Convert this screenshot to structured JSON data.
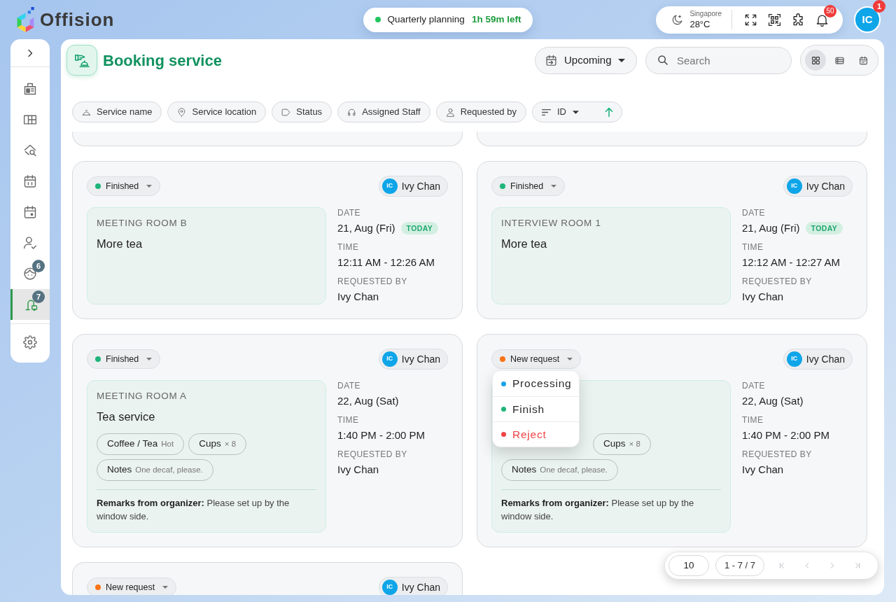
{
  "topbar": {
    "logo": "Offision",
    "timer": {
      "label": "Quarterly planning",
      "remaining": "1h 59m left"
    },
    "weather": {
      "city": "Singapore",
      "temperature": "28°C"
    },
    "notifications": "50",
    "user": {
      "initials": "IC",
      "badge": "1"
    }
  },
  "sidebar": {
    "items": [
      {
        "selected": false
      },
      {
        "selected": false
      },
      {
        "selected": false
      },
      {
        "selected": false
      },
      {
        "selected": false
      },
      {
        "selected": false
      },
      {
        "badge": "6",
        "selected": false
      },
      {
        "badge": "7",
        "selected": true
      }
    ]
  },
  "header": {
    "title": "Booking service",
    "period": "Upcoming",
    "search": {
      "placeholder": "Search"
    },
    "views": [
      {
        "selected": true
      },
      {
        "selected": false
      },
      {
        "selected": false
      }
    ]
  },
  "filters": [
    {
      "label": "Service name"
    },
    {
      "label": "Service location"
    },
    {
      "label": "Status"
    },
    {
      "label": "Assigned Staff"
    },
    {
      "label": "Requested by"
    }
  ],
  "sort": {
    "field": "ID",
    "ascending": true
  },
  "cards": [
    {
      "kind": "clipped_bottom"
    },
    {
      "kind": "clipped_bottom"
    },
    {
      "kind": "full",
      "status": {
        "label": "Finished",
        "color": "#1fb57a"
      },
      "requester": {
        "initials": "IC",
        "name": "Ivy Chan"
      },
      "location": "MEETING ROOM B",
      "title": "More tea",
      "fields": [
        {
          "label": "DATE",
          "value": "21, Aug (Fri)",
          "badge": "TODAY"
        },
        {
          "label": "TIME",
          "value": "12:11 AM - 12:26 AM"
        },
        {
          "label": "REQUESTED BY",
          "value": "Ivy Chan"
        }
      ]
    },
    {
      "kind": "full",
      "status": {
        "label": "Finished",
        "color": "#1fb57a"
      },
      "requester": {
        "initials": "IC",
        "name": "Ivy Chan"
      },
      "location": "INTERVIEW ROOM 1",
      "title": "More tea",
      "fields": [
        {
          "label": "DATE",
          "value": "21, Aug (Fri)",
          "badge": "TODAY"
        },
        {
          "label": "TIME",
          "value": "12:12 AM - 12:27 AM"
        },
        {
          "label": "REQUESTED BY",
          "value": "Ivy Chan"
        }
      ]
    },
    {
      "kind": "full",
      "status": {
        "label": "Finished",
        "color": "#1fb57a"
      },
      "requester": {
        "initials": "IC",
        "name": "Ivy Chan"
      },
      "location": "MEETING ROOM A",
      "title": "Tea service",
      "requests": [
        {
          "kind": "item",
          "name": "Coffee / Tea",
          "detail": "Hot"
        },
        {
          "kind": "item",
          "name": "Cups",
          "detail": "× 8"
        },
        {
          "kind": "item",
          "name": "Notes",
          "detail": "One decaf, please."
        }
      ],
      "remarks": "**Remarks from organizer:** Please set up by the window side.",
      "fields": [
        {
          "label": "DATE",
          "value": "22, Aug (Sat)"
        },
        {
          "label": "TIME",
          "value": "1:40 PM - 2:00 PM"
        },
        {
          "label": "REQUESTED BY",
          "value": "Ivy Chan"
        }
      ]
    },
    {
      "kind": "full",
      "status": {
        "label": "New request",
        "color": "#f97316",
        "menu": [
          {
            "label": "Processing",
            "color": "#1aa3e8",
            "danger": false
          },
          {
            "label": "Finish",
            "color": "#1fb57a",
            "danger": false
          },
          {
            "label": "Reject",
            "color": "#ef4444",
            "danger": true
          }
        ]
      },
      "requester": {
        "initials": "IC",
        "name": "Ivy Chan"
      },
      "requests": [
        {
          "kind": "covered"
        },
        {
          "kind": "item",
          "name": "Cups",
          "detail": "× 8"
        },
        {
          "kind": "item",
          "name": "Notes",
          "detail": "One decaf, please."
        }
      ],
      "remarks": "**Remarks from organizer:** Please set up by the window side.",
      "fields": [
        {
          "label": "DATE",
          "value": "22, Aug (Sat)"
        },
        {
          "label": "TIME",
          "value": "1:40 PM - 2:00 PM"
        },
        {
          "label": "REQUESTED BY",
          "value": "Ivy Chan"
        }
      ]
    },
    {
      "kind": "clipped_top",
      "status": {
        "label": "New request",
        "color": "#f97316"
      },
      "requester": {
        "initials": "IC",
        "name": "Ivy Chan"
      }
    }
  ],
  "pagination": {
    "page_size": "10",
    "range": "1 - 7 / 7",
    "nav": [
      {
        "disabled": true
      },
      {
        "disabled": true
      },
      {
        "disabled": true
      },
      {
        "disabled": true
      }
    ]
  }
}
